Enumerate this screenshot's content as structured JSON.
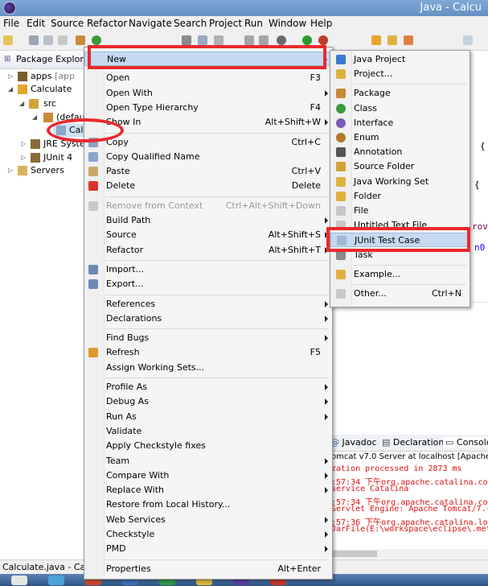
{
  "window": {
    "title": "Java - Calcu"
  },
  "menubar": [
    "File",
    "Edit",
    "Source",
    "Refactor",
    "Navigate",
    "Search",
    "Project",
    "Run",
    "Window",
    "Help"
  ],
  "package_explorer": {
    "tab_label": "Package Explore",
    "tree": [
      {
        "label": "apps",
        "suffix": "[app",
        "indent": 0,
        "twisty": "▷"
      },
      {
        "label": "Calculate",
        "suffix": "",
        "indent": 0,
        "twisty": "◢"
      },
      {
        "label": "src",
        "suffix": "",
        "indent": 1,
        "twisty": "◢"
      },
      {
        "label": "(defau",
        "suffix": "",
        "indent": 2,
        "twisty": "◢"
      },
      {
        "label": "Calc",
        "suffix": "",
        "indent": 3,
        "twisty": ""
      },
      {
        "label": "JRE Syste",
        "suffix": "",
        "indent": 1,
        "twisty": "▷"
      },
      {
        "label": "JUnit 4",
        "suffix": "",
        "indent": 1,
        "twisty": "▷"
      },
      {
        "label": "Servers",
        "suffix": "",
        "indent": 0,
        "twisty": "▷"
      }
    ]
  },
  "context_menu": {
    "items": [
      {
        "label": "New",
        "shortcut": "",
        "submenu": true,
        "highlighted": true,
        "icon": ""
      },
      {
        "sep": true
      },
      {
        "label": "Open",
        "shortcut": "F3",
        "icon": ""
      },
      {
        "label": "Open With",
        "shortcut": "",
        "submenu": true,
        "icon": ""
      },
      {
        "label": "Open Type Hierarchy",
        "shortcut": "F4",
        "icon": ""
      },
      {
        "label": "Show In",
        "shortcut": "Alt+Shift+W",
        "submenu": true,
        "icon": ""
      },
      {
        "sep": true
      },
      {
        "label": "Copy",
        "shortcut": "Ctrl+C",
        "icon": "copy-icon"
      },
      {
        "label": "Copy Qualified Name",
        "shortcut": "",
        "icon": "copy-icon"
      },
      {
        "label": "Paste",
        "shortcut": "Ctrl+V",
        "icon": "paste-icon"
      },
      {
        "label": "Delete",
        "shortcut": "Delete",
        "icon": "delete-icon"
      },
      {
        "sep": true
      },
      {
        "label": "Remove from Context",
        "shortcut": "Ctrl+Alt+Shift+Down",
        "disabled": true,
        "icon": "remove-context-icon"
      },
      {
        "label": "Build Path",
        "shortcut": "",
        "submenu": true,
        "icon": ""
      },
      {
        "label": "Source",
        "shortcut": "Alt+Shift+S",
        "submenu": true,
        "icon": ""
      },
      {
        "label": "Refactor",
        "shortcut": "Alt+Shift+T",
        "submenu": true,
        "icon": ""
      },
      {
        "sep": true
      },
      {
        "label": "Import...",
        "shortcut": "",
        "icon": "import-icon"
      },
      {
        "label": "Export...",
        "shortcut": "",
        "icon": "export-icon"
      },
      {
        "sep": true
      },
      {
        "label": "References",
        "shortcut": "",
        "submenu": true,
        "icon": ""
      },
      {
        "label": "Declarations",
        "shortcut": "",
        "submenu": true,
        "icon": ""
      },
      {
        "sep": true
      },
      {
        "label": "Find Bugs",
        "shortcut": "",
        "submenu": true,
        "icon": ""
      },
      {
        "label": "Refresh",
        "shortcut": "F5",
        "icon": "refresh-icon"
      },
      {
        "label": "Assign Working Sets...",
        "shortcut": "",
        "icon": ""
      },
      {
        "sep": true
      },
      {
        "label": "Profile As",
        "shortcut": "",
        "submenu": true,
        "icon": ""
      },
      {
        "label": "Debug As",
        "shortcut": "",
        "submenu": true,
        "icon": ""
      },
      {
        "label": "Run As",
        "shortcut": "",
        "submenu": true,
        "icon": ""
      },
      {
        "label": "Validate",
        "shortcut": "",
        "icon": ""
      },
      {
        "label": "Apply Checkstyle fixes",
        "shortcut": "",
        "icon": ""
      },
      {
        "label": "Team",
        "shortcut": "",
        "submenu": true,
        "icon": ""
      },
      {
        "label": "Compare With",
        "shortcut": "",
        "submenu": true,
        "icon": ""
      },
      {
        "label": "Replace With",
        "shortcut": "",
        "submenu": true,
        "icon": ""
      },
      {
        "label": "Restore from Local History...",
        "shortcut": "",
        "icon": ""
      },
      {
        "label": "Web Services",
        "shortcut": "",
        "submenu": true,
        "icon": ""
      },
      {
        "label": "Checkstyle",
        "shortcut": "",
        "submenu": true,
        "icon": ""
      },
      {
        "label": "PMD",
        "shortcut": "",
        "submenu": true,
        "icon": ""
      },
      {
        "sep": true
      },
      {
        "label": "Properties",
        "shortcut": "Alt+Enter",
        "icon": ""
      }
    ]
  },
  "new_submenu": {
    "items": [
      {
        "label": "Java Project",
        "shortcut": "",
        "icon": "java-project-icon"
      },
      {
        "label": "Project...",
        "shortcut": "",
        "icon": "project-icon"
      },
      {
        "sep": true
      },
      {
        "label": "Package",
        "shortcut": "",
        "icon": "package-icon"
      },
      {
        "label": "Class",
        "shortcut": "",
        "icon": "class-icon"
      },
      {
        "label": "Interface",
        "shortcut": "",
        "icon": "interface-icon"
      },
      {
        "label": "Enum",
        "shortcut": "",
        "icon": "enum-icon"
      },
      {
        "label": "Annotation",
        "shortcut": "",
        "icon": "annotation-icon"
      },
      {
        "label": "Source Folder",
        "shortcut": "",
        "icon": "source-folder-icon"
      },
      {
        "label": "Java Working Set",
        "shortcut": "",
        "icon": "working-set-icon"
      },
      {
        "label": "Folder",
        "shortcut": "",
        "icon": "folder-icon"
      },
      {
        "label": "File",
        "shortcut": "",
        "icon": "file-icon"
      },
      {
        "label": "Untitled Text File",
        "shortcut": "",
        "icon": "text-file-icon"
      },
      {
        "label": "JUnit Test Case",
        "shortcut": "",
        "highlighted": true,
        "icon": "junit-icon"
      },
      {
        "label": "Task",
        "shortcut": "",
        "icon": "task-icon"
      },
      {
        "sep": true
      },
      {
        "label": "Example...",
        "shortcut": "",
        "icon": "example-icon"
      },
      {
        "sep": true
      },
      {
        "label": "Other...",
        "shortcut": "Ctrl+N",
        "icon": "other-icon"
      }
    ]
  },
  "editor_fragments": [
    "{",
    "{",
    "rov",
    "n0"
  ],
  "console": {
    "tabs": [
      "Javadoc",
      "Declaration",
      "Console"
    ],
    "header": "omcat v7.0 Server at localhost [Apache",
    "lines": [
      "zation processed in 2873 ms",
      ":57:34 下午org.apache.catalina.cor",
      " service Catalina",
      ":57:34 下午org.apache.catalina.cor",
      " Servlet Engine: Apache Tomcat/7.(",
      ":57:36 下午org.apache.catalina.loa",
      "JarFile(E:\\workspace\\eclipse\\.met"
    ]
  },
  "status_bar": {
    "text": "Calculate.java - Calcu"
  },
  "colors": {
    "highlight": "#c5daf1",
    "annotation_red": "#e8292e",
    "console_red": "#d11111"
  }
}
